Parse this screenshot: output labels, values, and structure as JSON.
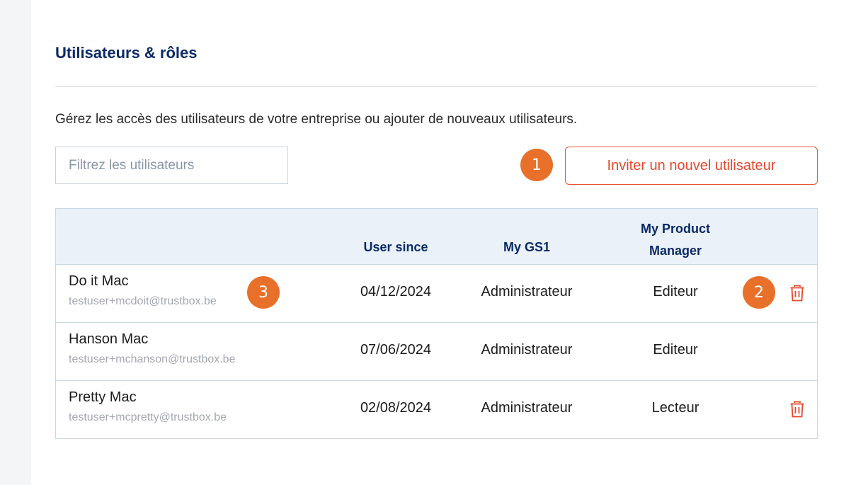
{
  "page": {
    "title": "Utilisateurs & rôles",
    "description": "Gérez les accès des utilisateurs de votre entreprise ou ajouter de nouveaux utilisateurs."
  },
  "filter": {
    "placeholder": "Filtrez les utilisateurs",
    "value": ""
  },
  "invite_button": {
    "label": "Inviter un nouvel utilisateur"
  },
  "badges": {
    "one": "1",
    "two": "2",
    "three": "3"
  },
  "table": {
    "headers": {
      "user_since": "User since",
      "my_gs1": "My GS1",
      "my_product_manager_line1": "My Product",
      "my_product_manager_line2": "Manager"
    },
    "rows": [
      {
        "name": "Do it Mac",
        "email": "testuser+mcdoit@trustbox.be",
        "since": "04/12/2024",
        "gs1": "Administrateur",
        "pm": "Editeur",
        "delete_icon": "trash-icon"
      },
      {
        "name": "Hanson Mac",
        "email": "testuser+mchanson@trustbox.be",
        "since": "07/06/2024",
        "gs1": "Administrateur",
        "pm": "Editeur"
      },
      {
        "name": "Pretty Mac",
        "email": "testuser+mcpretty@trustbox.be",
        "since": "02/08/2024",
        "gs1": "Administrateur",
        "pm": "Lecteur",
        "delete_icon": "trash-icon"
      }
    ]
  },
  "colors": {
    "title": "#0b2a66",
    "accent": "#e5492a",
    "badge": "#e8702a",
    "header_bg": "#eaf1f8"
  }
}
